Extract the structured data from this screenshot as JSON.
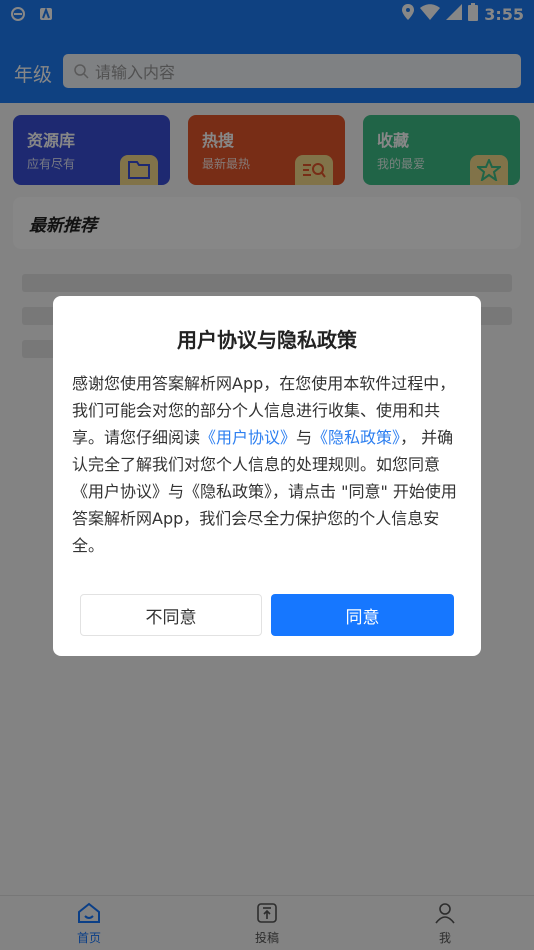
{
  "status_bar": {
    "time": "3:55"
  },
  "header": {
    "grade_label": "年级",
    "search_placeholder": "请输入内容"
  },
  "cards": [
    {
      "title": "资源库",
      "subtitle": "应有尽有",
      "color": "#3a4fd6",
      "icon": "book-icon"
    },
    {
      "title": "热搜",
      "subtitle": "最新最热",
      "color": "#e3562a",
      "icon": "search-list-icon"
    },
    {
      "title": "收藏",
      "subtitle": "我的最爱",
      "color": "#3dbd86",
      "icon": "star-icon"
    }
  ],
  "recommend": {
    "title": "最新推荐"
  },
  "dialog": {
    "title": "用户协议与隐私政策",
    "body_parts": {
      "p1": "感谢您使用答案解析网App，在您使用本软件过程中，我们可能会对您的部分个人信息进行收集、使用和共享。请您仔细阅读",
      "link1": "《用户协议》",
      "p2": "与",
      "link2": "《隐私政策》",
      "p3": "， 并确认完全了解我们对您个人信息的处理规则。如您同意《用户协议》与《隐私政策》，请点击 \"同意\" 开始使用答案解析网App，我们会尽全力保护您的个人信息安全。"
    },
    "disagree_label": "不同意",
    "agree_label": "同意"
  },
  "bottom_nav": [
    {
      "label": "首页",
      "icon": "home-icon",
      "active": true
    },
    {
      "label": "投稿",
      "icon": "upload-icon",
      "active": false
    },
    {
      "label": "我",
      "icon": "user-icon",
      "active": false
    }
  ],
  "colors": {
    "primary": "#1d7bf4",
    "agree_button": "#1677ff",
    "link": "#2d7ff0"
  }
}
